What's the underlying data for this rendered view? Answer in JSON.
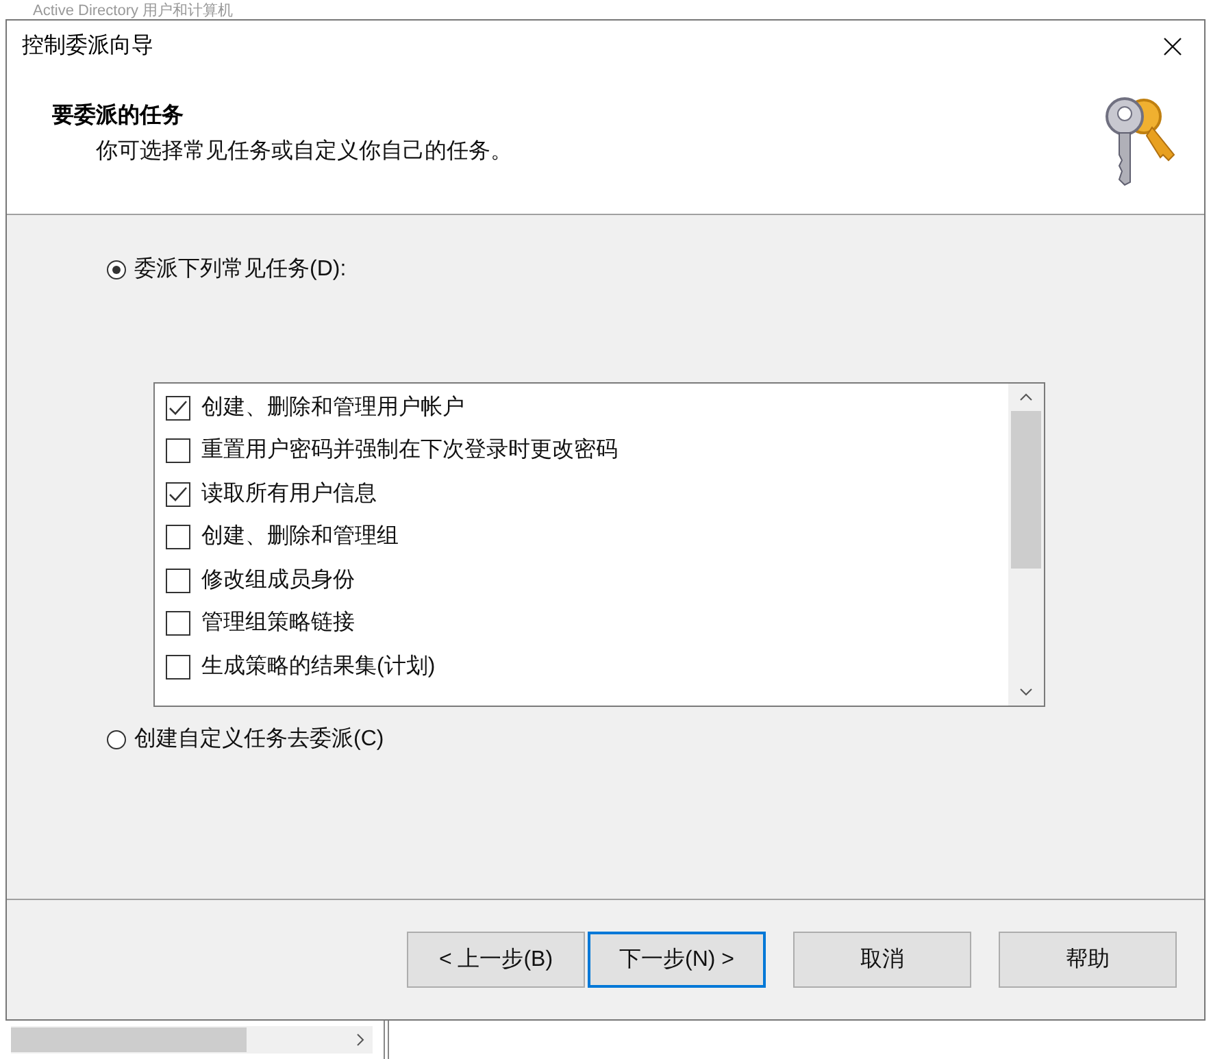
{
  "background_window": {
    "title": "Active Directory 用户和计算机"
  },
  "window": {
    "title": "控制委派向导"
  },
  "header": {
    "title": "要委派的任务",
    "subtitle": "你可选择常见任务或自定义你自己的任务。"
  },
  "options": [
    {
      "label": "委派下列常见任务(D):",
      "selected": true
    },
    {
      "label": "创建自定义任务去委派(C)",
      "selected": false
    }
  ],
  "tasks": [
    {
      "label": "创建、删除和管理用户帐户",
      "checked": true
    },
    {
      "label": "重置用户密码并强制在下次登录时更改密码",
      "checked": false
    },
    {
      "label": "读取所有用户信息",
      "checked": true
    },
    {
      "label": "创建、删除和管理组",
      "checked": false
    },
    {
      "label": "修改组成员身份",
      "checked": false
    },
    {
      "label": "管理组策略链接",
      "checked": false
    },
    {
      "label": "生成策略的结果集(计划)",
      "checked": false
    }
  ],
  "buttons": [
    {
      "label": "< 上一步(B)",
      "focused": false
    },
    {
      "label": "下一步(N) >",
      "focused": true
    },
    {
      "label": "取消",
      "focused": false
    },
    {
      "label": "帮助",
      "focused": false
    }
  ]
}
